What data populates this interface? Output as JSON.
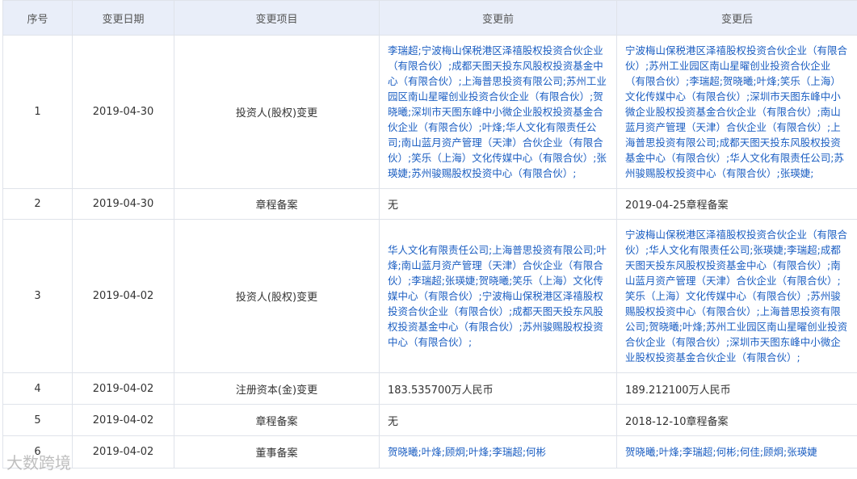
{
  "headers": [
    "序号",
    "变更日期",
    "变更项目",
    "变更前",
    "变更后"
  ],
  "rows": [
    {
      "idx": "1",
      "date": "2019-04-30",
      "item": "投资人(股权)变更",
      "before": "李瑞超;宁波梅山保税港区泽禧股权投资合伙企业（有限合伙）;成都天图天投东风股权投资基金中心（有限合伙）;上海普思投资有限公司;苏州工业园区南山星曜创业投资合伙企业（有限合伙）;贺晓曦;深圳市天图东峰中小微企业股权投资基金合伙企业（有限合伙）;叶烽;华人文化有限责任公司;南山蓝月资产管理（天津）合伙企业（有限合伙）;笑乐（上海）文化传媒中心（有限合伙）;张瑛婕;苏州骏赐股权投资中心（有限合伙）;",
      "after": "宁波梅山保税港区泽禧股权投资合伙企业（有限合伙）;苏州工业园区南山星曜创业投资合伙企业（有限合伙）;李瑞超;贺晓曦;叶烽;笑乐（上海）文化传媒中心（有限合伙）;深圳市天图东峰中小微企业股权投资基金合伙企业（有限合伙）;南山蓝月资产管理（天津）合伙企业（有限合伙）;上海普思投资有限公司;成都天图天投东风股权投资基金中心（有限合伙）;华人文化有限责任公司;苏州骏赐股权投资中心（有限合伙）;张瑛婕;"
    },
    {
      "idx": "2",
      "date": "2019-04-30",
      "item": "章程备案",
      "before": "无",
      "after": "2019-04-25章程备案"
    },
    {
      "idx": "3",
      "date": "2019-04-02",
      "item": "投资人(股权)变更",
      "before": "华人文化有限责任公司;上海普思投资有限公司;叶烽;南山蓝月资产管理（天津）合伙企业（有限合伙）;李瑞超;张瑛婕;贺晓曦;笑乐（上海）文化传媒中心（有限合伙）;宁波梅山保税港区泽禧股权投资合伙企业（有限合伙）;成都天图天投东风股权投资基金中心（有限合伙）;苏州骏赐股权投资中心（有限合伙）;",
      "after": "宁波梅山保税港区泽禧股权投资合伙企业（有限合伙）;华人文化有限责任公司;张瑛婕;李瑞超;成都天图天投东风股权投资基金中心（有限合伙）;南山蓝月资产管理（天津）合伙企业（有限合伙）;笑乐（上海）文化传媒中心（有限合伙）;苏州骏赐股权投资中心（有限合伙）;上海普思投资有限公司;贺晓曦;叶烽;苏州工业园区南山星曜创业投资合伙企业（有限合伙）;深圳市天图东峰中小微企业股权投资基金合伙企业（有限合伙）;"
    },
    {
      "idx": "4",
      "date": "2019-04-02",
      "item": "注册资本(金)变更",
      "before": "183.535700万人民币",
      "after": "189.212100万人民币"
    },
    {
      "idx": "5",
      "date": "2019-04-02",
      "item": "章程备案",
      "before": "无",
      "after": "2018-12-10章程备案"
    },
    {
      "idx": "6",
      "date": "2019-04-02",
      "item": "董事备案",
      "before": "贺晓曦;叶烽;顾炯;叶烽;李瑞超;何彬",
      "after": "贺晓曦;叶烽;李瑞超;何彬;何佳;顾炯;张瑛婕"
    }
  ],
  "watermark": "大数跨境"
}
